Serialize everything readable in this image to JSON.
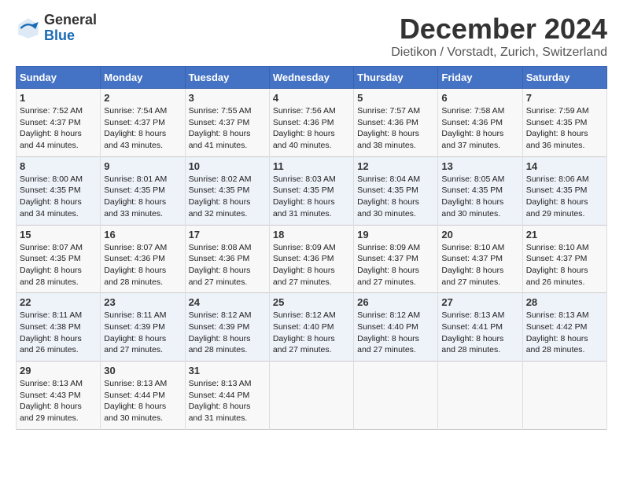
{
  "header": {
    "logo_general": "General",
    "logo_blue": "Blue",
    "month_title": "December 2024",
    "location": "Dietikon / Vorstadt, Zurich, Switzerland"
  },
  "days_of_week": [
    "Sunday",
    "Monday",
    "Tuesday",
    "Wednesday",
    "Thursday",
    "Friday",
    "Saturday"
  ],
  "weeks": [
    [
      {
        "day": 1,
        "sunrise": "7:52 AM",
        "sunset": "4:37 PM",
        "daylight": "8 hours and 44 minutes."
      },
      {
        "day": 2,
        "sunrise": "7:54 AM",
        "sunset": "4:37 PM",
        "daylight": "8 hours and 43 minutes."
      },
      {
        "day": 3,
        "sunrise": "7:55 AM",
        "sunset": "4:37 PM",
        "daylight": "8 hours and 41 minutes."
      },
      {
        "day": 4,
        "sunrise": "7:56 AM",
        "sunset": "4:36 PM",
        "daylight": "8 hours and 40 minutes."
      },
      {
        "day": 5,
        "sunrise": "7:57 AM",
        "sunset": "4:36 PM",
        "daylight": "8 hours and 38 minutes."
      },
      {
        "day": 6,
        "sunrise": "7:58 AM",
        "sunset": "4:36 PM",
        "daylight": "8 hours and 37 minutes."
      },
      {
        "day": 7,
        "sunrise": "7:59 AM",
        "sunset": "4:35 PM",
        "daylight": "8 hours and 36 minutes."
      }
    ],
    [
      {
        "day": 8,
        "sunrise": "8:00 AM",
        "sunset": "4:35 PM",
        "daylight": "8 hours and 34 minutes."
      },
      {
        "day": 9,
        "sunrise": "8:01 AM",
        "sunset": "4:35 PM",
        "daylight": "8 hours and 33 minutes."
      },
      {
        "day": 10,
        "sunrise": "8:02 AM",
        "sunset": "4:35 PM",
        "daylight": "8 hours and 32 minutes."
      },
      {
        "day": 11,
        "sunrise": "8:03 AM",
        "sunset": "4:35 PM",
        "daylight": "8 hours and 31 minutes."
      },
      {
        "day": 12,
        "sunrise": "8:04 AM",
        "sunset": "4:35 PM",
        "daylight": "8 hours and 30 minutes."
      },
      {
        "day": 13,
        "sunrise": "8:05 AM",
        "sunset": "4:35 PM",
        "daylight": "8 hours and 30 minutes."
      },
      {
        "day": 14,
        "sunrise": "8:06 AM",
        "sunset": "4:35 PM",
        "daylight": "8 hours and 29 minutes."
      }
    ],
    [
      {
        "day": 15,
        "sunrise": "8:07 AM",
        "sunset": "4:35 PM",
        "daylight": "8 hours and 28 minutes."
      },
      {
        "day": 16,
        "sunrise": "8:07 AM",
        "sunset": "4:36 PM",
        "daylight": "8 hours and 28 minutes."
      },
      {
        "day": 17,
        "sunrise": "8:08 AM",
        "sunset": "4:36 PM",
        "daylight": "8 hours and 27 minutes."
      },
      {
        "day": 18,
        "sunrise": "8:09 AM",
        "sunset": "4:36 PM",
        "daylight": "8 hours and 27 minutes."
      },
      {
        "day": 19,
        "sunrise": "8:09 AM",
        "sunset": "4:37 PM",
        "daylight": "8 hours and 27 minutes."
      },
      {
        "day": 20,
        "sunrise": "8:10 AM",
        "sunset": "4:37 PM",
        "daylight": "8 hours and 27 minutes."
      },
      {
        "day": 21,
        "sunrise": "8:10 AM",
        "sunset": "4:37 PM",
        "daylight": "8 hours and 26 minutes."
      }
    ],
    [
      {
        "day": 22,
        "sunrise": "8:11 AM",
        "sunset": "4:38 PM",
        "daylight": "8 hours and 26 minutes."
      },
      {
        "day": 23,
        "sunrise": "8:11 AM",
        "sunset": "4:39 PM",
        "daylight": "8 hours and 27 minutes."
      },
      {
        "day": 24,
        "sunrise": "8:12 AM",
        "sunset": "4:39 PM",
        "daylight": "8 hours and 28 minutes."
      },
      {
        "day": 25,
        "sunrise": "8:12 AM",
        "sunset": "4:40 PM",
        "daylight": "8 hours and 27 minutes."
      },
      {
        "day": 26,
        "sunrise": "8:12 AM",
        "sunset": "4:40 PM",
        "daylight": "8 hours and 27 minutes."
      },
      {
        "day": 27,
        "sunrise": "8:13 AM",
        "sunset": "4:41 PM",
        "daylight": "8 hours and 28 minutes."
      },
      {
        "day": 28,
        "sunrise": "8:13 AM",
        "sunset": "4:42 PM",
        "daylight": "8 hours and 28 minutes."
      }
    ],
    [
      {
        "day": 29,
        "sunrise": "8:13 AM",
        "sunset": "4:43 PM",
        "daylight": "8 hours and 29 minutes."
      },
      {
        "day": 30,
        "sunrise": "8:13 AM",
        "sunset": "4:44 PM",
        "daylight": "8 hours and 30 minutes."
      },
      {
        "day": 31,
        "sunrise": "8:13 AM",
        "sunset": "4:44 PM",
        "daylight": "8 hours and 31 minutes."
      },
      null,
      null,
      null,
      null
    ]
  ]
}
